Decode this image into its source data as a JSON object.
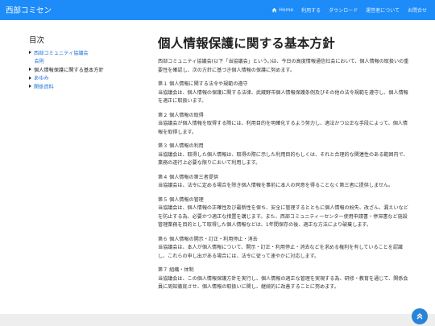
{
  "brand": "西部コミセン",
  "nav": {
    "home": "Home",
    "usage": "利用する",
    "download": "ダウンロード",
    "about": "運営者について",
    "contact": "お問合せ"
  },
  "toc": {
    "title": "目次",
    "items": [
      {
        "label": "西部コミュニティ協議会"
      },
      {
        "label": "会則"
      },
      {
        "label": "個人情報保護に関する基本方針"
      },
      {
        "label": "あゆみ"
      },
      {
        "label": "関係資料"
      }
    ]
  },
  "main": {
    "title": "個人情報保護に関する基本方針",
    "intro": "西部コミュニティ協議会(以下「当協議会」という。)は、今日の高度情報通信社会において、個人情報の取扱いの重要性を確認し、次の方針に基づき個人情報の保護に努めます。",
    "sections": [
      {
        "heading": "第１ 個人情報に関する法令や規範の遵守",
        "body": "当協議会は、個人情報の保護に関する法律、武蔵野市個人情報保護条例及びその他の法令規範を遵守し、個人情報を適正に取扱います。"
      },
      {
        "heading": "第２ 個人情報の取得",
        "body": "当協議会が個人情報を取得する際には、利用目的を明確化するよう努力し、適法かつ公正な手段によって、個人情報を取得します。"
      },
      {
        "heading": "第３ 個人情報の利用",
        "body": "当協議会は、取得した個人情報は、取得の際に示した利用目的もしくは、それと合理的な関連性のある範囲内で、業務の遂行上必要な限りにおいて利用します。"
      },
      {
        "heading": "第４ 個人情報の第三者提供",
        "body": "当協議会は、法令に定める場合を除き個人情報を事前に本人の同意を得ることなく第三者に提供しません。"
      },
      {
        "heading": "第５ 個人情報の管理",
        "body": "当協議会は、個人情報の正確性及び最新性を保ち、安全に管理するとともに個人情報の紛失、改ざん、漏えいなどを防止する為、必要かつ適正な措置を講じます。また、西部コミュニティーセンター使用申請書・停滞書など施設管理業務を目的として取得した個人情報などは、1年間保存の後、適正な方法により破棄します。"
      },
      {
        "heading": "第６ 個人情報の開示・訂正・利用停止・消去",
        "body": "当協議会は、本人が個人情報について、開示・訂正・利用停止・消去などを求める権利を有していることを認識し、これらの申し出がある場合には、法令に従って速やかに対応します。"
      },
      {
        "heading": "第７ 組織・体制",
        "body": "当協議会は、この個人情報保護方針を実行し、個人情報の適正な管理を実現する為、研修・教育を通じて、関係会員に周知徹底させ、個人情報の取扱いに関し、継続的に改善することに努めます。"
      }
    ]
  }
}
